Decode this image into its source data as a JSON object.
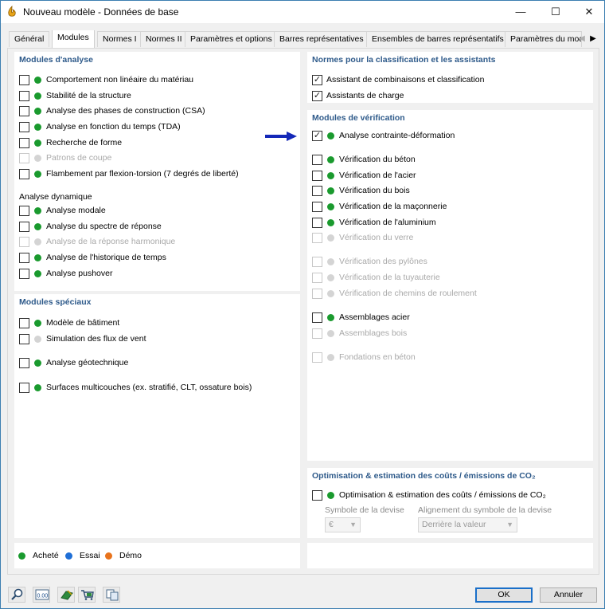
{
  "window": {
    "title": "Nouveau modèle - Données de base",
    "minimize": "—",
    "maximize": "☐",
    "close": "✕"
  },
  "tabs": [
    {
      "label": "Général"
    },
    {
      "label": "Modules"
    },
    {
      "label": "Normes I"
    },
    {
      "label": "Normes II"
    },
    {
      "label": "Paramètres et options"
    },
    {
      "label": "Barres représentatives"
    },
    {
      "label": "Ensembles de barres représentatifs"
    },
    {
      "label": "Paramètres du mod"
    }
  ],
  "analysis": {
    "title": "Modules d'analyse",
    "items": [
      {
        "label": "Comportement non linéaire du matériau",
        "checked": false,
        "status": "green"
      },
      {
        "label": "Stabilité de la structure",
        "checked": false,
        "status": "green"
      },
      {
        "label": "Analyse des phases de construction (CSA)",
        "checked": false,
        "status": "green"
      },
      {
        "label": "Analyse en fonction du temps (TDA)",
        "checked": false,
        "status": "green"
      },
      {
        "label": "Recherche de forme",
        "checked": false,
        "status": "green"
      },
      {
        "label": "Patrons de coupe",
        "checked": false,
        "status": "grey",
        "disabled": true
      },
      {
        "label": "Flambement par flexion-torsion (7 degrés de liberté)",
        "checked": false,
        "status": "green"
      }
    ],
    "dynamic_title": "Analyse dynamique",
    "dynamic_items": [
      {
        "label": "Analyse modale",
        "checked": false,
        "status": "green"
      },
      {
        "label": "Analyse du spectre de réponse",
        "checked": false,
        "status": "green"
      },
      {
        "label": "Analyse de la réponse harmonique",
        "checked": false,
        "status": "grey",
        "disabled": true
      },
      {
        "label": "Analyse de l'historique de temps",
        "checked": false,
        "status": "green"
      },
      {
        "label": "Analyse pushover",
        "checked": false,
        "status": "green"
      }
    ]
  },
  "special": {
    "title": "Modules spéciaux",
    "items": [
      {
        "label": "Modèle de bâtiment",
        "checked": false,
        "status": "green"
      },
      {
        "label": "Simulation des flux de vent",
        "checked": false,
        "status": "grey"
      },
      {
        "label": "Analyse géotechnique",
        "checked": false,
        "status": "green"
      },
      {
        "label": "Surfaces multicouches (ex. stratifié, CLT, ossature bois)",
        "checked": false,
        "status": "green"
      }
    ]
  },
  "norms": {
    "title": "Normes pour la classification et les assistants",
    "items": [
      {
        "label": "Assistant de combinaisons et classification",
        "checked": true
      },
      {
        "label": "Assistants de charge",
        "checked": true
      }
    ]
  },
  "verification": {
    "title": "Modules de vérification",
    "items": [
      {
        "label": "Analyse contrainte-déformation",
        "checked": true,
        "status": "green"
      },
      {
        "label": "Vérification du béton",
        "checked": false,
        "status": "green"
      },
      {
        "label": "Vérification de l'acier",
        "checked": false,
        "status": "green"
      },
      {
        "label": "Vérification du bois",
        "checked": false,
        "status": "green"
      },
      {
        "label": "Vérification de la maçonnerie",
        "checked": false,
        "status": "green"
      },
      {
        "label": "Vérification de l'aluminium",
        "checked": false,
        "status": "green"
      },
      {
        "label": "Vérification du verre",
        "checked": false,
        "status": "grey",
        "disabled": true
      },
      {
        "label": "Vérification des pylônes",
        "checked": false,
        "status": "grey",
        "disabled": true
      },
      {
        "label": "Vérification de la tuyauterie",
        "checked": false,
        "status": "grey",
        "disabled": true
      },
      {
        "label": "Vérification de chemins de roulement",
        "checked": false,
        "status": "grey",
        "disabled": true
      },
      {
        "label": "Assemblages acier",
        "checked": false,
        "status": "green"
      },
      {
        "label": "Assemblages bois",
        "checked": false,
        "status": "grey",
        "disabled": true
      },
      {
        "label": "Fondations en béton",
        "checked": false,
        "status": "grey",
        "disabled": true
      }
    ]
  },
  "optimization": {
    "title": "Optimisation & estimation des coûts / émissions de CO₂",
    "item_label": "Optimisation & estimation des coûts / émissions de CO₂",
    "checked": false,
    "status": "green",
    "currency_label": "Symbole de la devise",
    "currency_value": "€",
    "alignment_label": "Alignement du symbole de la devise",
    "alignment_value": "Derrière la valeur"
  },
  "legend": [
    {
      "label": "Acheté",
      "color": "#1a9a2e"
    },
    {
      "label": "Essai",
      "color": "#1f6fd6"
    },
    {
      "label": "Démo",
      "color": "#e8731c"
    }
  ],
  "toolbar": {
    "icons": [
      "search-help-icon",
      "units-icon",
      "model-settings-icon",
      "cart-icon",
      "copy-icon"
    ],
    "units_text": "0.00"
  },
  "buttons": {
    "ok": "OK",
    "cancel": "Annuler"
  }
}
